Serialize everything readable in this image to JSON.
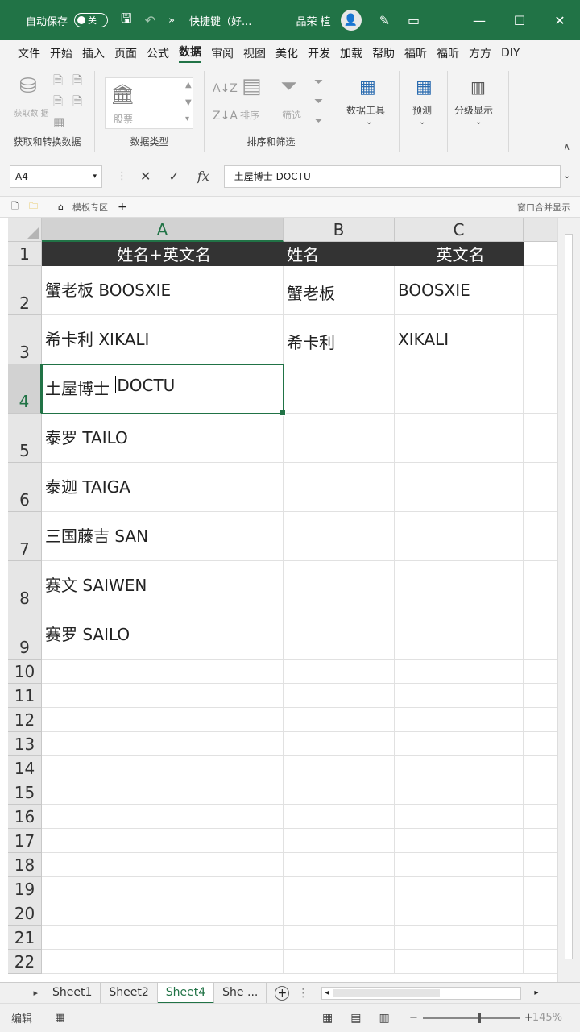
{
  "titlebar": {
    "autosave_label": "自动保存",
    "autosave_state": "关",
    "doc_title": "快捷键（好...",
    "user_name": "品荣 植",
    "controls": [
      "—",
      "☐",
      "✕"
    ]
  },
  "ribbon_tabs": [
    "文件",
    "开始",
    "插入",
    "页面",
    "公式",
    "数据",
    "审阅",
    "视图",
    "美化",
    "开发",
    "加载",
    "帮助",
    "福昕",
    "福昕",
    "方方",
    "DIY"
  ],
  "active_tab": "数据",
  "ribbon": {
    "get_data_label": "获取数\n据",
    "stocks_label": "股票",
    "sort_label": "排序",
    "filter_label": "筛选",
    "data_tools_label": "数据工具",
    "forecast_label": "预测",
    "outline_label": "分级显示",
    "group1": "获取和转换数据",
    "group2": "数据类型",
    "group3": "排序和筛选",
    "collapse": "∧"
  },
  "formula_bar": {
    "name_box": "A4",
    "cancel": "✕",
    "confirm": "✓",
    "fx": "fx",
    "content": "土屋博士 DOCTU"
  },
  "doc_row": {
    "template_tab": "模板专区",
    "add": "+",
    "merge_label": "窗口合并显示"
  },
  "sheet": {
    "columns": [
      "A",
      "B",
      "C"
    ],
    "selected_column": "A",
    "selected_row": 4,
    "header_row": [
      "姓名+英文名",
      "姓名",
      "英文名"
    ],
    "rows": [
      [
        "蟹老板 BOOSXIE",
        "蟹老板",
        "BOOSXIE"
      ],
      [
        "希卡利 XIKALI",
        "希卡利",
        "XIKALI"
      ],
      [
        "土屋博士 DOCTU",
        "",
        ""
      ],
      [
        "泰罗 TAILO",
        "",
        ""
      ],
      [
        "泰迦 TAIGA",
        "",
        ""
      ],
      [
        "三国藤吉 SAN",
        "",
        ""
      ],
      [
        "赛文 SAIWEN",
        "",
        ""
      ],
      [
        "赛罗 SAILO",
        "",
        ""
      ]
    ],
    "row_numbers": [
      "1",
      "2",
      "3",
      "4",
      "5",
      "6",
      "7",
      "8",
      "9",
      "10",
      "11",
      "12",
      "13",
      "14",
      "15",
      "16",
      "17",
      "18",
      "19",
      "20",
      "21",
      "22"
    ],
    "active_cell_before_caret": "土屋博士 ",
    "active_cell_after_caret": "DOCTU"
  },
  "sheet_tabs": [
    "Sheet1",
    "Sheet2",
    "Sheet4",
    "She ..."
  ],
  "active_sheet": "Sheet4",
  "status": {
    "mode": "编辑",
    "zoom_minus": "−",
    "zoom_plus": "+",
    "zoom_pct": "145%"
  },
  "colors": {
    "accent": "#217346",
    "header_fill": "#333333"
  }
}
